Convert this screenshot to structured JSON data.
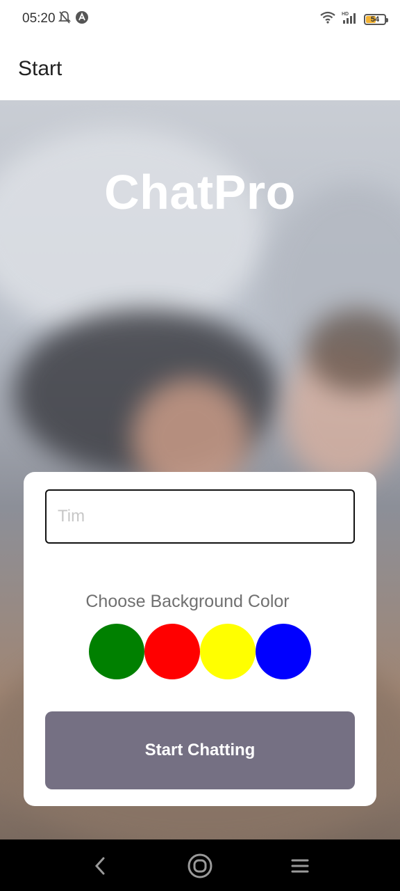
{
  "status_bar": {
    "time": "05:20",
    "battery_level": "54",
    "battery_fraction": 0.54,
    "icons": [
      "bell-off-icon",
      "app-a-icon",
      "wifi-icon",
      "hd-icon",
      "signal-icon",
      "battery-icon"
    ]
  },
  "app_bar": {
    "title": "Start"
  },
  "hero": {
    "title": "ChatPro"
  },
  "form": {
    "name_placeholder": "Tim",
    "color_label": "Choose Background Color",
    "colors": [
      "#008000",
      "#ff0000",
      "#ffff00",
      "#0000ff"
    ],
    "start_button_label": "Start Chatting",
    "button_color": "#757083"
  },
  "nav_bar": {
    "icons": [
      "back-icon",
      "home-icon",
      "menu-icon"
    ]
  }
}
